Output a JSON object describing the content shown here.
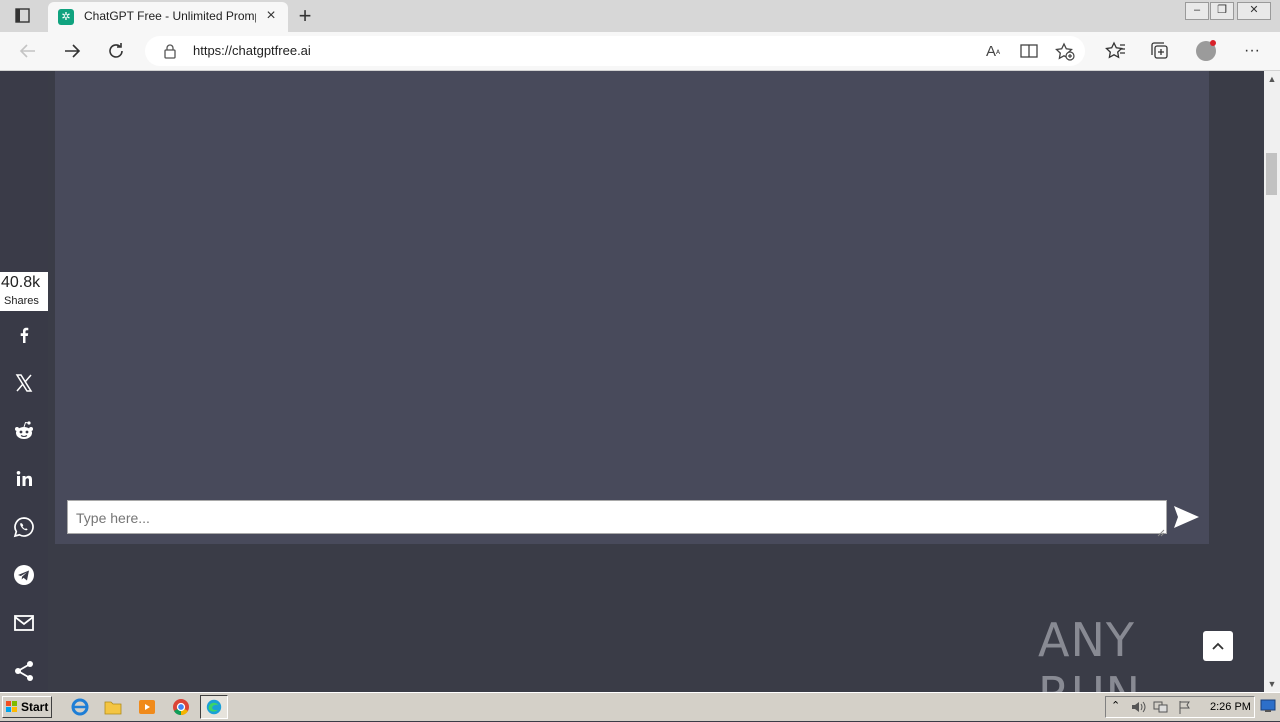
{
  "browser": {
    "tab_title": "ChatGPT Free - Unlimited Promp",
    "tab_close": "×",
    "new_tab": "+",
    "url": "https://chatgptfree.ai",
    "window_minimize": "–",
    "window_restore": "❐",
    "window_close": "✕"
  },
  "page": {
    "chat_input_placeholder": "Type here...",
    "share_count": "40.8k",
    "share_label": "Shares",
    "social_items": [
      {
        "name": "facebook"
      },
      {
        "name": "x"
      },
      {
        "name": "reddit"
      },
      {
        "name": "linkedin"
      },
      {
        "name": "whatsapp"
      },
      {
        "name": "telegram"
      },
      {
        "name": "email"
      },
      {
        "name": "share"
      }
    ],
    "watermark": "ANY RUN"
  },
  "taskbar": {
    "start_label": "Start",
    "clock": "2:26 PM"
  },
  "colors": {
    "page_bg": "#3a3c47",
    "chat_panel_bg": "#484a5b",
    "chatgpt_green": "#10a37f"
  }
}
